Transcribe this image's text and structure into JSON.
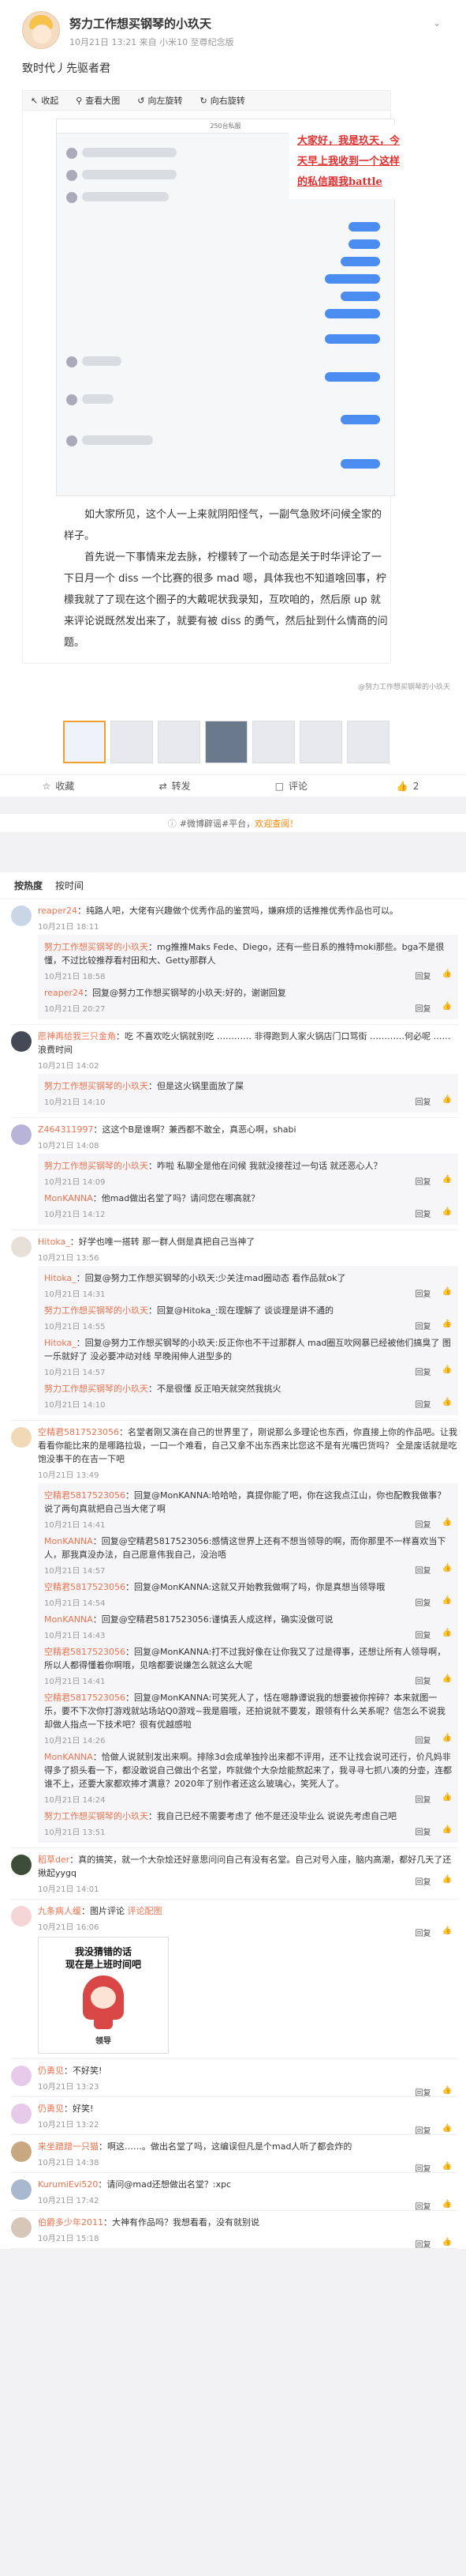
{
  "post": {
    "author": "努力工作想买钢琴的小玖天",
    "meta": "10月21日 13:21 来自 小米10 至尊纪念版",
    "text": "致时代丿先驱者君",
    "toolbar": [
      "收起",
      "查看大图",
      "向左旋转",
      "向右旋转"
    ],
    "shot_title": "250台私服",
    "annotation": "大家好，我是玖天，今天早上我收到一个这样的私信跟我battle",
    "paragraphs": [
      "如大家所见，这个人一上来就阴阳怪气，一副气急败坏问候全家的样子。",
      "首先说一下事情来龙去脉，柠檬转了一个动态是关于时华评论了一下日月一个 diss 一个比赛的很多 mad 嗯，具体我也不知道啥回事，柠檬我就了了现在这个圈子的大戴呢状我录知，互吹咱的，然后原 up 就来评论说既然发出来了，就要有被 diss 的勇气，然后扯到什么情商的问题。"
    ],
    "watermark": "@努力工作想买钢琴的小玖天",
    "actions": {
      "collect": "收藏",
      "repost": "转发",
      "comment": "评论",
      "like": "2"
    }
  },
  "notice": {
    "prefix": "#微博辟谣#平台，",
    "link": "欢迎查阅！"
  },
  "comment_tabs": [
    "按热度",
    "按时间"
  ],
  "comments": [
    {
      "user": "reaper24",
      "text": "纯路人吧，大佬有兴趣做个优秀作品的鉴赏吗，嫌麻烦的话推推优秀作品也可以。",
      "time": "10月21日 18:11",
      "color": "#c8d6e6",
      "replies": [
        {
          "user": "努力工作想买钢琴的小玖天",
          "text": "mg推推Maks Fede、Diego，还有一些日系的推特moki那些。bga不是很懂，不过比较推荐看村田和大、Getty那群人",
          "time": "10月21日 18:58"
        },
        {
          "user": "reaper24",
          "text": "回复@努力工作想买钢琴的小玖天:好的，谢谢回复",
          "time": "10月21日 20:27"
        }
      ]
    },
    {
      "user": "愿神再给我三只金角",
      "text": "吃 不喜欢吃火锅就别吃 ………… 非得跑到人家火锅店门口骂街 …………何必呢 ……浪费时间",
      "time": "10月21日 14:02",
      "color": "#444a55",
      "replies": [
        {
          "user": "努力工作想买钢琴的小玖天",
          "text": "但是这火锅里面放了屎",
          "time": "10月21日 14:10"
        }
      ]
    },
    {
      "user": "Z464311997",
      "text": "这这个B是谁啊？兼西都不敢全，真恶心啊，shabi",
      "time": "10月21日 14:08",
      "color": "#b7b3d9",
      "replies": [
        {
          "user": "努力工作想买钢琴的小玖天",
          "text": "咋啦 私聊全是他在问候 我就没接茬过一句话 就还恶心人？",
          "time": "10月21日 14:09"
        },
        {
          "user": "MonKANNA",
          "text": "他mad做出名堂了吗？请问您在哪高就？",
          "time": "10月21日 14:12"
        }
      ]
    },
    {
      "user": "Hitoka_",
      "text": "好学也唯一搭转 那一群人倒是真把自己当神了",
      "time": "10月21日 13:56",
      "color": "#e6e0d8",
      "replies": [
        {
          "user": "Hitoka_",
          "text": "回复@努力工作想买钢琴的小玖天:少关注mad圈动态 看作品就ok了",
          "time": "10月21日 14:31"
        },
        {
          "user": "努力工作想买钢琴的小玖天",
          "text": "回复@Hitoka_:现在理解了 谈谈理是讲不通的",
          "time": "10月21日 14:55"
        },
        {
          "user": "Hitoka_",
          "text": "回复@努力工作想买钢琴的小玖天:反正你也不干过那群人 mad圈互吹网暴已经被他们搞臭了 图一乐就好了 没必要冲动对线 早晚闹伸人进型多的",
          "time": "10月21日 14:57"
        },
        {
          "user": "努力工作想买钢琴的小玖天",
          "text": "不是很懂 反正咱天就突然我挑火",
          "time": "10月21日 14:10"
        }
      ]
    },
    {
      "user": "空精君5817523056",
      "text": "名堂者刚又演在自己的世界里了，刚说那么多理论也东西，你直接上你的作品吧。让我看看你能比来的是哪路拉圾，一口一个难看，自己又拿不出东西来比您这不是有光嘴巴货吗？ 全是废话就是吃饱没事干的在吉一下吧",
      "time": "10月21日 13:49",
      "color": "#f0d9b4",
      "replies": [
        {
          "user": "空精君5817523056",
          "text": "回复@MonKANNA:哈哈哈，真提你能了吧，你在这我点江山，你也配教我做事？说了两句真就把自己当大佬了啊",
          "time": "10月21日 14:41"
        },
        {
          "user": "MonKANNA",
          "text": "回复@空精君5817523056:感情这世界上还有不想当领导的啊，而你那里不一样喜欢当下人，那我真没办法，自己愿意伟我自己，没治唔",
          "time": "10月21日 14:57"
        },
        {
          "user": "空精君5817523056",
          "text": "回复@MonKANNA:这就又开始教我做啊了吗，你是真想当领导哦",
          "time": "10月21日 14:54"
        },
        {
          "user": "MonKANNA",
          "text": "回复@空精君5817523056:谨慎丢人成这样，确实没做可说",
          "time": "10月21日 14:43"
        },
        {
          "user": "空精君5817523056",
          "text": "回复@MonKANNA:打不过我好像在让你我又了过是得事，还想让所有人领导啊，所以人都得懂着你啊哦，见啥都要说嫌怎么就这么大呢",
          "time": "10月21日 14:41"
        },
        {
          "user": "空精君5817523056",
          "text": "回复@MonKANNA:可笑死人了，恬在嗯静谭说我的想要被你搾碎？本来就图一乐，要不下次你打游戏就站场站Q0游戏~我是眉哦，还拍说就不要发，跟领有什么关系呢？信怎么不说我却做人指点一下技术吧？很有优越感啦",
          "time": "10月21日 14:26"
        },
        {
          "user": "MonKANNA",
          "text": "恰做人说就别发出来啊。排除3d会成单独拎出来都不评用，还不让找会说可还行，价凡妈非得多了损头看一下，都没敢说自己做出个名堂，咋就做个大杂烩能熬起来了，我寻寻七抓八凑的分壶，连都谁不上，还要大家都欢捧才满意？2020年了别作者还这么玻璃心，笑死人了。",
          "time": "10月21日 14:24"
        },
        {
          "user": "努力工作想买钢琴的小玖天",
          "text": "我自己已经不需要考虑了 他不是还没毕业么 说说先考虑自己吧",
          "time": "10月21日 13:51"
        }
      ]
    },
    {
      "user": "稻草der",
      "text": "真的搞笑，就一个大杂烩还好意思问问自己有没有名堂。自己对号入座，脑内高潮，都好几天了还揪起yygq",
      "time": "10月21日 14:01",
      "color": "#3e4c3a",
      "replies": []
    },
    {
      "user": "九条病人缓",
      "text": "图片评论",
      "time": "10月21日 16:06",
      "color": "#f5d5d5",
      "image": {
        "text": "我没猜错的话\n现在是上班时间吧",
        "caption": "领导"
      },
      "replies": []
    },
    {
      "user": "仍勇见",
      "text": "不好笑!",
      "time": "10月21日 13:23",
      "color": "#e7c9ea",
      "replies": []
    },
    {
      "user": "仍勇见",
      "text": "好笑!",
      "time": "10月21日 13:22",
      "color": "#e7c9ea",
      "replies": []
    },
    {
      "user": "来坐蹭蹭一只猫",
      "text": "啊这……。做出名堂了吗，这编误但凡是个mad人听了都会炸的",
      "time": "10月21日 14:38",
      "color": "#c8a880",
      "replies": []
    },
    {
      "user": "KurumiEvi520",
      "text": "请问@mad还想做出名堂？:xpc",
      "time": "10月21日 17:42",
      "color": "#a9b8cf",
      "replies": []
    },
    {
      "user": "伯爵多少年2011",
      "text": "大神有作品吗？我想看看，没有就别说",
      "time": "10月21日 15:18",
      "color": "#d6c7b9",
      "replies": []
    }
  ],
  "ops": {
    "reply": "回复",
    "like": "赞"
  },
  "pic_comment": "评论配图"
}
